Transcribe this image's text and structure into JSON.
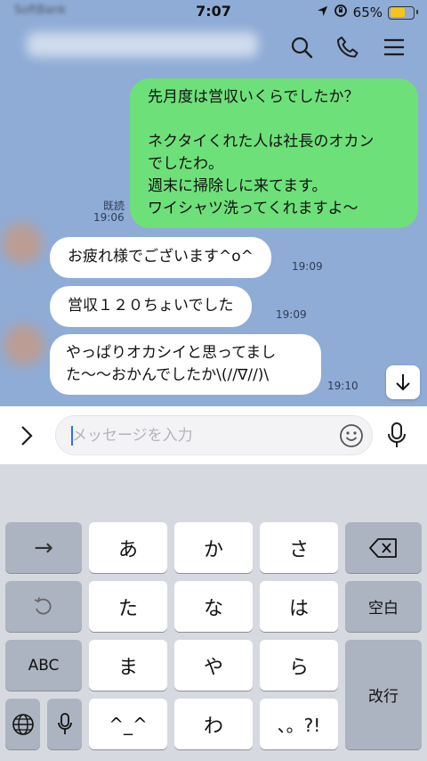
{
  "status": {
    "carrier": "SoftBank",
    "time": "7:07",
    "battery": "65%",
    "battery_level": 0.65
  },
  "header": {
    "icons": [
      "search-icon",
      "phone-icon",
      "menu-icon"
    ]
  },
  "messages": [
    {
      "side": "out",
      "text": "先月度は営収いくらでしたか？\n\nネクタイくれた人は社長のオカン\nでしたわ。\n週末に掃除しに来てます。\nワイシャツ洗ってくれますよ〜",
      "read": "既読",
      "time": "19:06"
    },
    {
      "side": "in",
      "text": "お疲れ様でございます^o^",
      "time": "19:09"
    },
    {
      "side": "in",
      "text": "営収１２０ちょいでした",
      "time": "19:09"
    },
    {
      "side": "in",
      "text": "やっぱりオカシイと思ってまし\nた〜〜おかんでしたか\\(//∇//)\\",
      "time": "19:10"
    }
  ],
  "input": {
    "placeholder": "メッセージを入力",
    "value": ""
  },
  "keyboard": {
    "arrow": "→",
    "undo": "↺",
    "abc": "ABC",
    "globe": "globe-icon",
    "mic": "mic-icon",
    "kana": [
      "あ",
      "か",
      "さ",
      "た",
      "な",
      "は",
      "ま",
      "や",
      "ら",
      "^_^",
      "わ",
      "、。?!"
    ],
    "delete": "⌫",
    "space": "空白",
    "enter": "改行"
  }
}
